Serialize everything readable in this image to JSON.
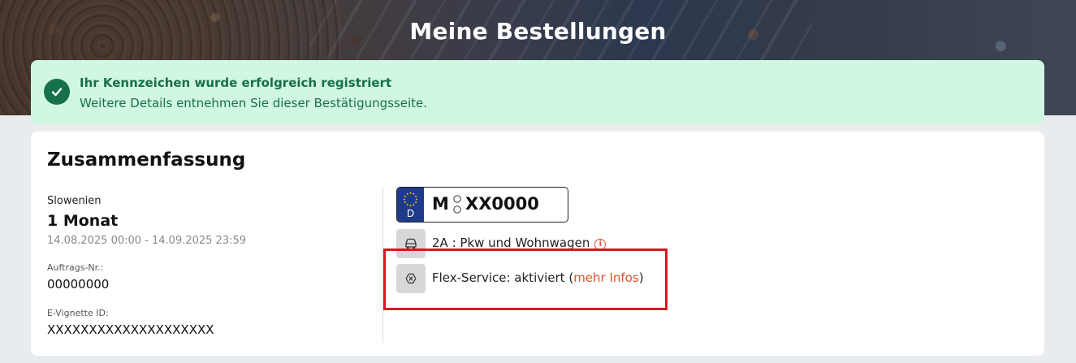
{
  "header": {
    "title": "Meine Bestellungen"
  },
  "alert": {
    "title": "Ihr Kennzeichen wurde erfolgreich registriert",
    "message": "Weitere Details entnehmen Sie dieser Bestätigungsseite."
  },
  "summary": {
    "heading": "Zusammenfassung",
    "country": "Slowenien",
    "duration": "1 Monat",
    "validity": "14.08.2025 00:00 - 14.09.2025 23:59",
    "order_label": "Auftrags-Nr.:",
    "order_number": "00000000",
    "vignette_label": "E-Vignette ID:",
    "vignette_id": "XXXXXXXXXXXXXXXXXXXX"
  },
  "plate": {
    "country_code": "D",
    "city": "M",
    "number": "XX0000"
  },
  "vehicle": {
    "category": "2A : Pkw und Wohnwagen"
  },
  "flex": {
    "prefix": "Flex-Service: aktiviert (",
    "link": "mehr Infos",
    "suffix": ")"
  },
  "colors": {
    "success_bg": "#d1f7e2",
    "success_text": "#16704a",
    "accent": "#e0522b",
    "highlight": "#d9171f"
  }
}
